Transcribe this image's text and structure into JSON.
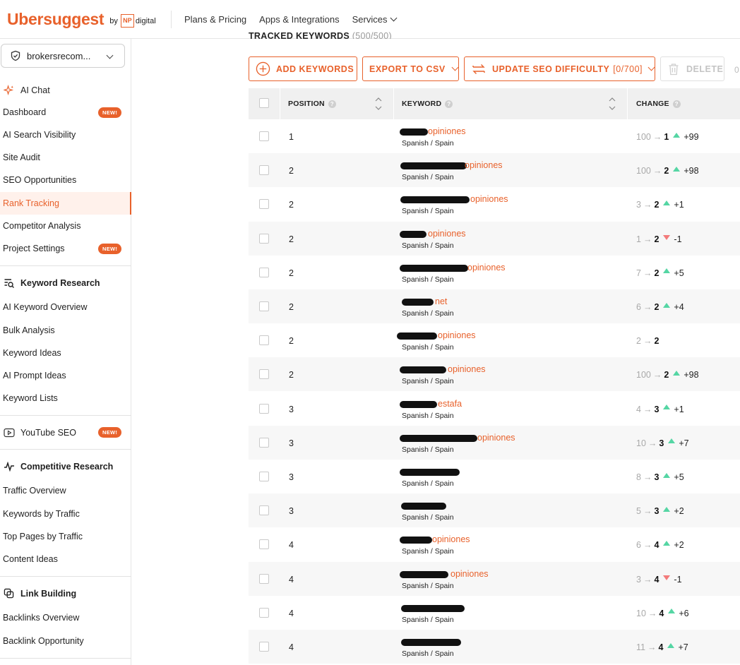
{
  "header": {
    "logo": "Ubersuggest",
    "logo_by": "by",
    "logo_np": "NP",
    "logo_digital": "digital",
    "nav": [
      {
        "label": "Plans & Pricing"
      },
      {
        "label": "Apps & Integrations"
      },
      {
        "label": "Services"
      }
    ]
  },
  "sidebar": {
    "project": "brokersrecom...",
    "new_badge": "NEW!",
    "ai_chat": "AI Chat",
    "project_items": [
      "Dashboard",
      "AI Search Visibility",
      "Site Audit",
      "SEO Opportunities",
      "Rank Tracking",
      "Competitor Analysis",
      "Project Settings"
    ],
    "keyword_research": {
      "title": "Keyword Research",
      "items": [
        "AI Keyword Overview",
        "Bulk Analysis",
        "Keyword Ideas",
        "AI Prompt Ideas",
        "Keyword Lists"
      ]
    },
    "youtube": "YouTube SEO",
    "competitive_research": {
      "title": "Competitive Research",
      "items": [
        "Traffic Overview",
        "Keywords by Traffic",
        "Top Pages by Traffic",
        "Content Ideas"
      ]
    },
    "link_building": {
      "title": "Link Building",
      "items": [
        "Backlinks Overview",
        "Backlink Opportunity"
      ]
    }
  },
  "main": {
    "section_title": "TRACKED KEYWORDS",
    "section_count": "(500/500)",
    "toolbar": {
      "add": "ADD KEYWORDS",
      "export": "EXPORT TO CSV",
      "update": "UPDATE SEO DIFFICULTY",
      "update_count": "[0/700]",
      "delete": "DELETE",
      "extra": "0"
    },
    "columns": {
      "position": "POSITION",
      "keyword": "KEYWORD",
      "change": "CHANGE"
    },
    "rows": [
      {
        "position": "1",
        "keyword": "opiniones",
        "lang": "Spanish / Spain",
        "from": "100",
        "to": "1",
        "dir": "up",
        "delta": "+99"
      },
      {
        "position": "2",
        "keyword": "opiniones",
        "lang": "Spanish / Spain",
        "from": "100",
        "to": "2",
        "dir": "up",
        "delta": "+98"
      },
      {
        "position": "2",
        "keyword": "opiniones",
        "lang": "Spanish / Spain",
        "from": "3",
        "to": "2",
        "dir": "up",
        "delta": "+1"
      },
      {
        "position": "2",
        "keyword": "opiniones",
        "lang": "Spanish / Spain",
        "from": "1",
        "to": "2",
        "dir": "down",
        "delta": "-1"
      },
      {
        "position": "2",
        "keyword": "opiniones",
        "lang": "Spanish / Spain",
        "from": "7",
        "to": "2",
        "dir": "up",
        "delta": "+5"
      },
      {
        "position": "2",
        "keyword": "net",
        "lang": "Spanish / Spain",
        "from": "6",
        "to": "2",
        "dir": "up",
        "delta": "+4"
      },
      {
        "position": "2",
        "keyword": "opiniones",
        "lang": "Spanish / Spain",
        "from": "2",
        "to": "2",
        "dir": "none",
        "delta": ""
      },
      {
        "position": "2",
        "keyword": "opiniones",
        "lang": "Spanish / Spain",
        "from": "100",
        "to": "2",
        "dir": "up",
        "delta": "+98"
      },
      {
        "position": "3",
        "keyword": "estafa",
        "lang": "Spanish / Spain",
        "from": "4",
        "to": "3",
        "dir": "up",
        "delta": "+1"
      },
      {
        "position": "3",
        "keyword": "opiniones",
        "lang": "Spanish / Spain",
        "from": "10",
        "to": "3",
        "dir": "up",
        "delta": "+7"
      },
      {
        "position": "3",
        "keyword": "",
        "lang": "Spanish / Spain",
        "from": "8",
        "to": "3",
        "dir": "up",
        "delta": "+5"
      },
      {
        "position": "3",
        "keyword": "",
        "lang": "Spanish / Spain",
        "from": "5",
        "to": "3",
        "dir": "up",
        "delta": "+2"
      },
      {
        "position": "4",
        "keyword": "opiniones",
        "lang": "Spanish / Spain",
        "from": "6",
        "to": "4",
        "dir": "up",
        "delta": "+2"
      },
      {
        "position": "4",
        "keyword": "opiniones",
        "lang": "Spanish / Spain",
        "from": "3",
        "to": "4",
        "dir": "down",
        "delta": "-1"
      },
      {
        "position": "4",
        "keyword": "",
        "lang": "Spanish / Spain",
        "from": "10",
        "to": "4",
        "dir": "up",
        "delta": "+6"
      },
      {
        "position": "4",
        "keyword": "",
        "lang": "Spanish / Spain",
        "from": "11",
        "to": "4",
        "dir": "up",
        "delta": "+7"
      }
    ],
    "colors": {
      "accent": "#e8612b",
      "up": "#55d6a4",
      "down": "#f37b7b"
    }
  }
}
